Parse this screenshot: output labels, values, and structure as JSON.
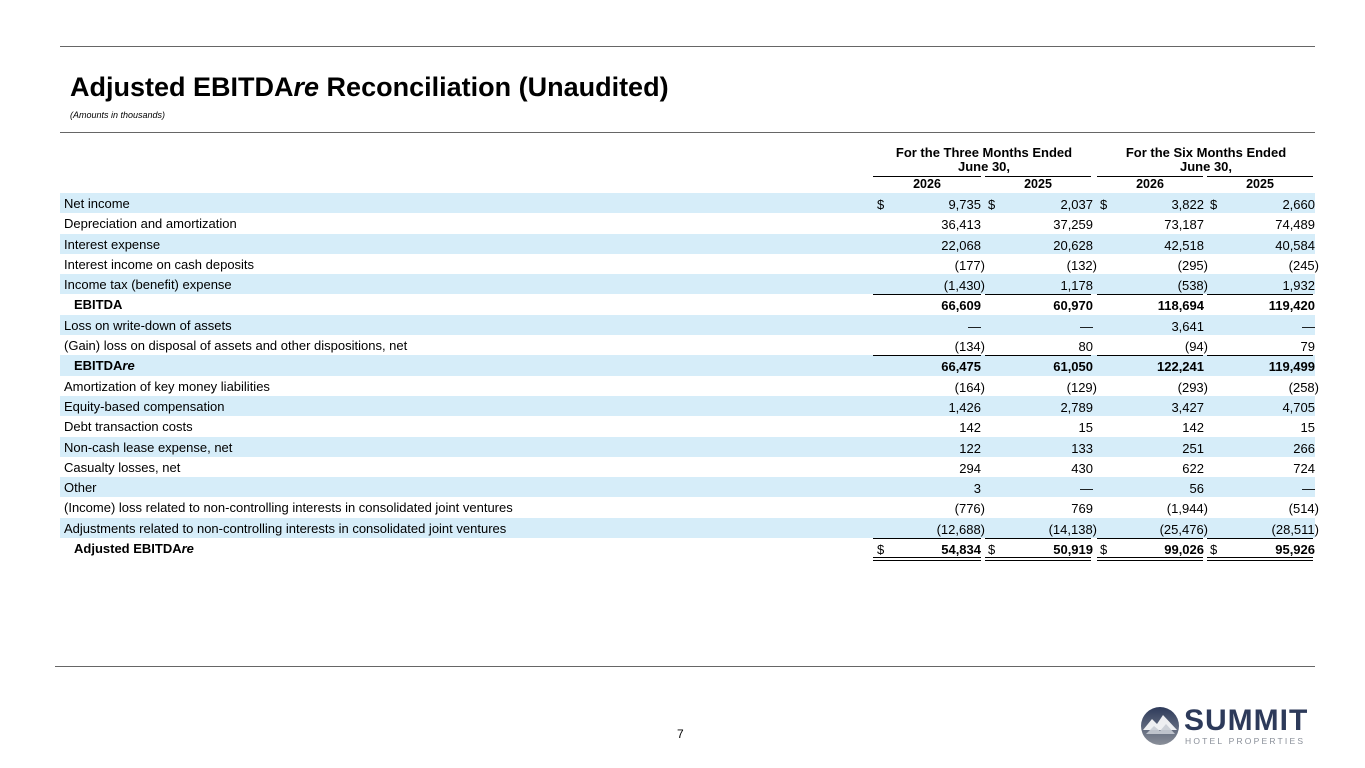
{
  "title": {
    "main": "Adjusted EBITDA",
    "italic": "re",
    "rest": " Reconciliation (Unaudited)"
  },
  "subtitle": "(Amounts in thousands)",
  "column_groups": [
    {
      "line1": "For the Three Months Ended",
      "line2": "June 30,"
    },
    {
      "line1": "For the Six Months Ended",
      "line2": "June 30,"
    }
  ],
  "years": [
    "2026",
    "2025",
    "2026",
    "2025"
  ],
  "rows": [
    {
      "label": "Net income",
      "values": [
        "9,735",
        "2,037",
        "3,822",
        "2,660"
      ],
      "dollar": true,
      "shaded": true
    },
    {
      "label": "Depreciation and amortization",
      "values": [
        "36,413",
        "37,259",
        "73,187",
        "74,489"
      ]
    },
    {
      "label": "Interest expense",
      "values": [
        "22,068",
        "20,628",
        "42,518",
        "40,584"
      ],
      "shaded": true
    },
    {
      "label": "Interest income on cash deposits",
      "values": [
        "(177)",
        "(132)",
        "(295)",
        "(245)"
      ]
    },
    {
      "label": "Income tax (benefit) expense",
      "values": [
        "(1,430)",
        "1,178",
        "(538)",
        "1,932"
      ],
      "shaded": true
    },
    {
      "label": "EBITDA",
      "values": [
        "66,609",
        "60,970",
        "118,694",
        "119,420"
      ],
      "bold": true,
      "topline": true
    },
    {
      "label": "Loss on write-down of assets",
      "values": [
        "—",
        "—",
        "3,641",
        "—"
      ],
      "shaded": true
    },
    {
      "label": "(Gain) loss on disposal of assets and other dispositions, net",
      "values": [
        "(134)",
        "80",
        "(94)",
        "79"
      ]
    },
    {
      "label": "EBITDA",
      "label_italic": "re",
      "values": [
        "66,475",
        "61,050",
        "122,241",
        "119,499"
      ],
      "bold": true,
      "topline": true,
      "shaded": true
    },
    {
      "label": "Amortization of key money liabilities",
      "values": [
        "(164)",
        "(129)",
        "(293)",
        "(258)"
      ]
    },
    {
      "label": "Equity-based compensation",
      "values": [
        "1,426",
        "2,789",
        "3,427",
        "4,705"
      ],
      "shaded": true
    },
    {
      "label": "Debt transaction costs",
      "values": [
        "142",
        "15",
        "142",
        "15"
      ]
    },
    {
      "label": "Non-cash lease expense, net",
      "values": [
        "122",
        "133",
        "251",
        "266"
      ],
      "shaded": true
    },
    {
      "label": "Casualty losses, net",
      "values": [
        "294",
        "430",
        "622",
        "724"
      ]
    },
    {
      "label": "Other",
      "values": [
        "3",
        "—",
        "56",
        "—"
      ],
      "shaded": true
    },
    {
      "label": "(Income) loss related to non-controlling interests in consolidated joint ventures",
      "values": [
        "(776)",
        "769",
        "(1,944)",
        "(514)"
      ]
    },
    {
      "label": "Adjustments related to non-controlling interests in consolidated joint ventures",
      "values": [
        "(12,688)",
        "(14,138)",
        "(25,476)",
        "(28,511)"
      ],
      "shaded": true
    },
    {
      "label": "Adjusted EBITDA",
      "label_italic": "re",
      "values": [
        "54,834",
        "50,919",
        "99,026",
        "95,926"
      ],
      "bold": true,
      "topline": true,
      "dollar": true,
      "doubleline": true
    }
  ],
  "currency_symbol": "$",
  "page_number": "7",
  "logo": {
    "name": "SUMMIT",
    "tagline": "HOTEL PROPERTIES",
    "colors": {
      "navy": "#2d3a5a",
      "gray": "#8a8f99"
    }
  },
  "colors": {
    "row_shade": "#d6edf9"
  }
}
